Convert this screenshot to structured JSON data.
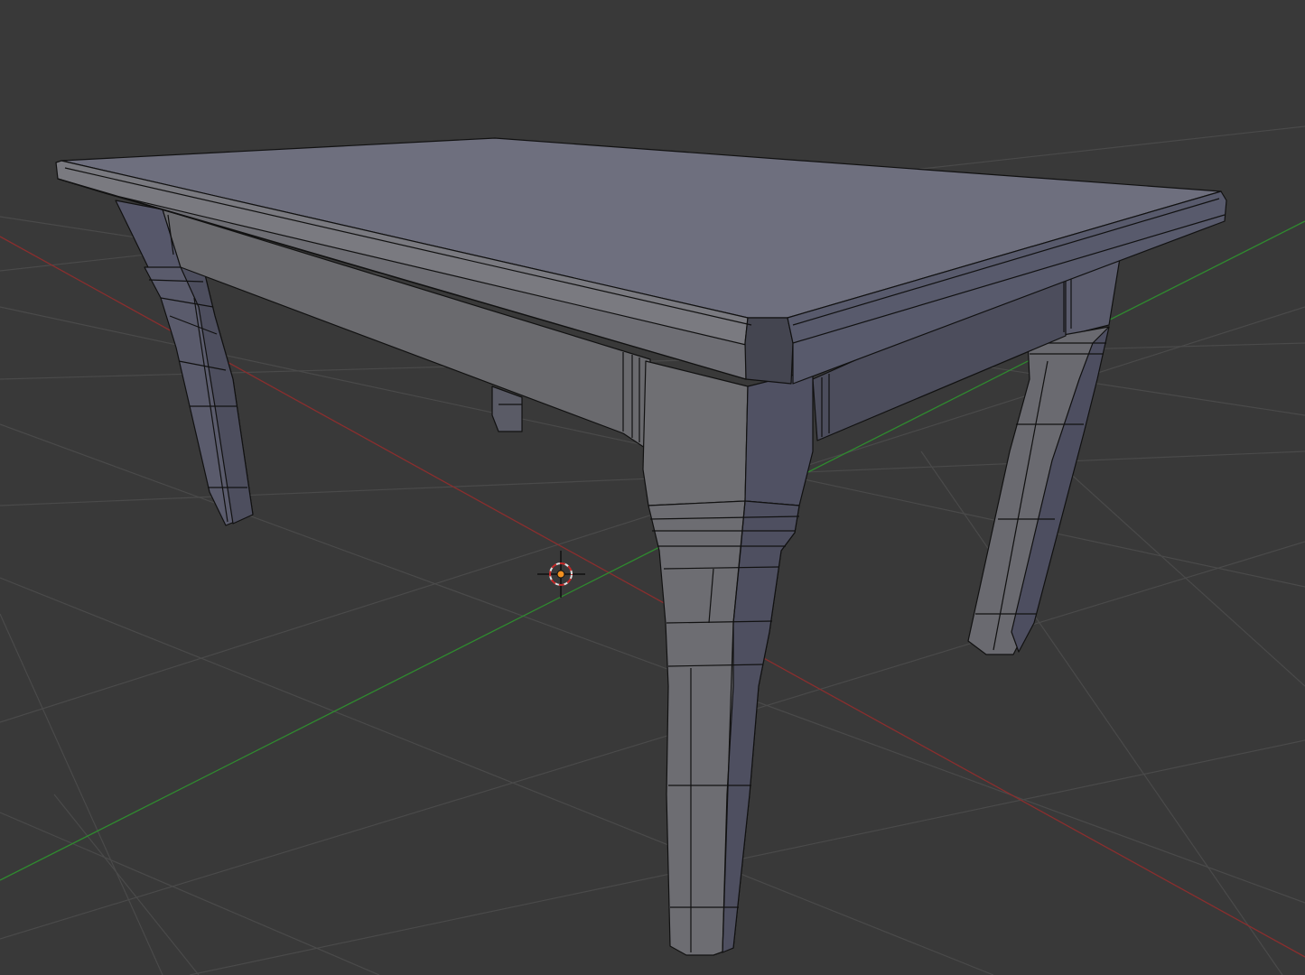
{
  "viewport": {
    "background": "#393939",
    "grid_color": "#4a4a4a",
    "x_axis_color": "#8a2e2e",
    "y_axis_color": "#2f8a2f",
    "cursor_icon": "3d-cursor-icon"
  },
  "mesh": {
    "object": "table",
    "shading": "solid",
    "wireframe_overlay": true,
    "colors": {
      "top": "#6e6f7e",
      "edge_front": "#7a7a80",
      "apron_front": "#6a6a6e",
      "apron_right": "#4c4d5c",
      "leg_front": "#6f6f73",
      "leg_side": "#4f5060",
      "wire": "#111111"
    }
  }
}
